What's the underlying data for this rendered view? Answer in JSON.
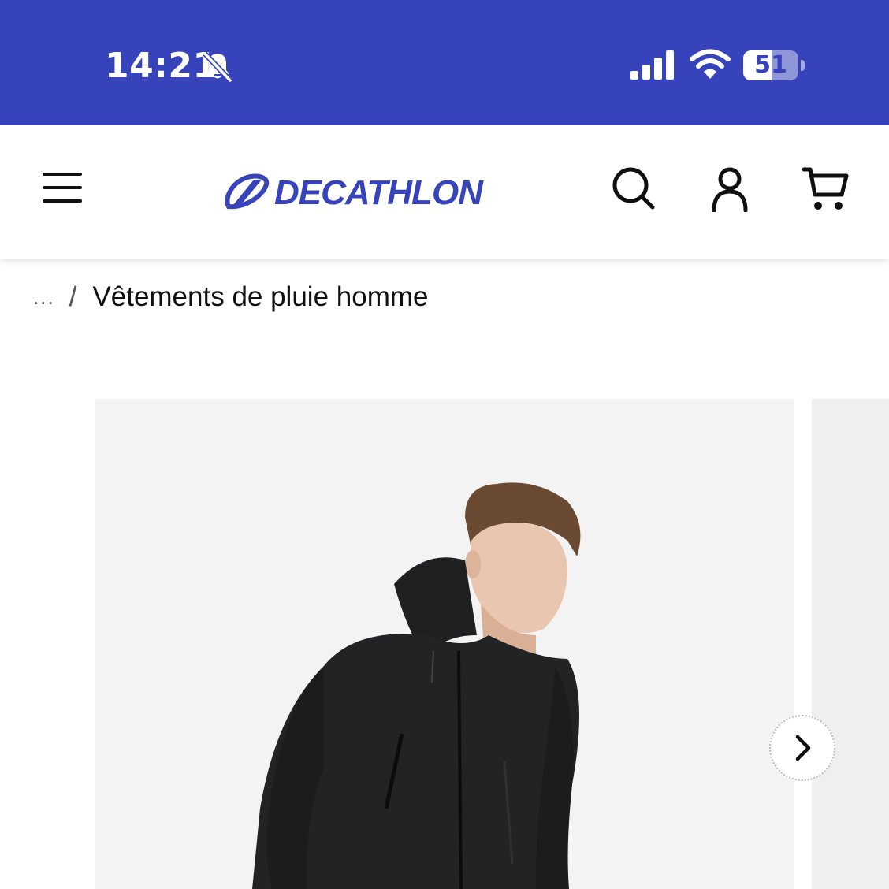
{
  "status_bar": {
    "time": "14:21",
    "battery_percent": "51",
    "battery_level": 0.51,
    "icons": [
      "bell-muted-icon",
      "cellular-signal-icon",
      "wifi-icon",
      "battery-icon"
    ]
  },
  "header": {
    "brand": "DECATHLON",
    "brand_color": "#3643BA",
    "icons": [
      "menu-icon",
      "search-icon",
      "account-icon",
      "cart-icon"
    ]
  },
  "breadcrumb": {
    "ellipsis": "...",
    "separator": "/",
    "current": "Vêtements de pluie homme"
  },
  "gallery": {
    "image": "product-photo-black-rain-jacket",
    "next_icon": "chevron-right-icon"
  }
}
